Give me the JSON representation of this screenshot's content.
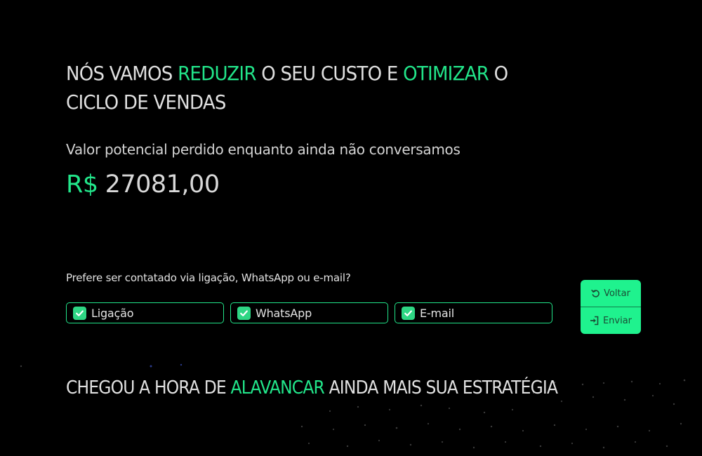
{
  "hero": {
    "title_part1": "NÓS VAMOS ",
    "title_accent1": "REDUZIR",
    "title_part2": " O SEU CUSTO E ",
    "title_accent2": "OTIMIZAR",
    "title_part3": " O CICLO DE VENDAS"
  },
  "loss": {
    "subtitle": "Valor potencial perdido enquanto ainda não conversamos",
    "currency": "R$",
    "value": "27081,00"
  },
  "contact": {
    "question": "Prefere ser contatado via ligação, WhatsApp ou e-mail?",
    "options": [
      {
        "label": "Ligação",
        "checked": true
      },
      {
        "label": "WhatsApp",
        "checked": true
      },
      {
        "label": "E-mail",
        "checked": true
      }
    ]
  },
  "actions": {
    "back_label": "Voltar",
    "send_label": "Enviar",
    "back_icon": "undo-icon",
    "send_icon": "sign-in-icon"
  },
  "cta": {
    "part1": "CHEGOU A HORA DE ",
    "accent": "ALAVANCAR",
    "part2": " AINDA MAIS SUA ESTRATÉGIA"
  },
  "colors": {
    "accent": "#22e58a",
    "button_bg": "#1ff28e",
    "background": "#000000"
  }
}
